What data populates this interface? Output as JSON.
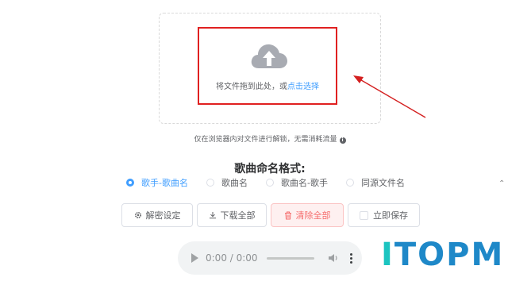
{
  "upload": {
    "prompt_text": "将文件拖到此处，或",
    "link_text": "点击选择"
  },
  "note": {
    "text": "仅在浏览器内对文件进行解锁，无需消耗流量",
    "info_icon": "info-icon"
  },
  "naming": {
    "title": "歌曲命名格式:",
    "options": [
      {
        "label": "歌手-歌曲名",
        "checked": true
      },
      {
        "label": "歌曲名",
        "checked": false
      },
      {
        "label": "歌曲名-歌手",
        "checked": false
      },
      {
        "label": "同源文件名",
        "checked": false
      }
    ]
  },
  "actions": {
    "decrypt_settings": "解密设定",
    "download_all": "下载全部",
    "clear_all": "清除全部",
    "save_now": "立即保存"
  },
  "player": {
    "time": "0:00 / 0:00"
  },
  "watermark": {
    "first_letter": "I",
    "rest": "TOPM"
  },
  "colors": {
    "accent": "#409eff",
    "danger": "#f56c6c",
    "highlight": "#e02020"
  }
}
